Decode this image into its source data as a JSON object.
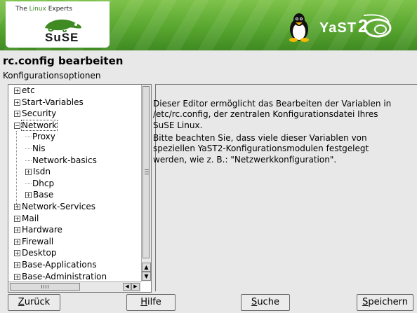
{
  "header": {
    "brand_tagline_prefix": "The ",
    "brand_tagline_highlight": "Linux",
    "brand_tagline_suffix": " Experts",
    "brand_name": "SuSE",
    "product_name": "YaST",
    "product_version": "2",
    "colors": {
      "banner": "#58a630",
      "logo_green": "#3f8a22"
    }
  },
  "dialog": {
    "title": "rc.config bearbeiten",
    "section_label": "Konfigurationsoptionen"
  },
  "tree": {
    "items": [
      {
        "label": "etc",
        "expander": "+",
        "level": 0
      },
      {
        "label": "Start-Variables",
        "expander": "+",
        "level": 0
      },
      {
        "label": "Security",
        "expander": "+",
        "level": 0
      },
      {
        "label": "Network",
        "expander": "−",
        "level": 0,
        "selected": true
      },
      {
        "label": "Proxy",
        "expander": "",
        "level": 1
      },
      {
        "label": "Nis",
        "expander": "",
        "level": 1
      },
      {
        "label": "Network-basics",
        "expander": "",
        "level": 1
      },
      {
        "label": "Isdn",
        "expander": "+",
        "level": 1
      },
      {
        "label": "Dhcp",
        "expander": "",
        "level": 1
      },
      {
        "label": "Base",
        "expander": "+",
        "level": 1
      },
      {
        "label": "Network-Services",
        "expander": "+",
        "level": 0
      },
      {
        "label": "Mail",
        "expander": "+",
        "level": 0
      },
      {
        "label": "Hardware",
        "expander": "+",
        "level": 0
      },
      {
        "label": "Firewall",
        "expander": "+",
        "level": 0
      },
      {
        "label": "Desktop",
        "expander": "+",
        "level": 0
      },
      {
        "label": "Base-Applications",
        "expander": "+",
        "level": 0
      },
      {
        "label": "Base-Administration",
        "expander": "+",
        "level": 0
      }
    ]
  },
  "help": {
    "paragraph1": "Dieser Editor ermöglicht das Bearbeiten der Variablen in /etc/rc.config, der zentralen Konfigurationsdatei Ihres SuSE Linux.",
    "paragraph2": "Bitte beachten Sie, dass viele dieser Variablen von speziellen YaST2-Konfigurationsmodulen festgelegt werden, wie z. B.: \"Netzwerkkonfiguration\"."
  },
  "buttons": {
    "back": {
      "mnemonic": "Z",
      "rest": "urück"
    },
    "help": {
      "mnemonic": "H",
      "rest": "ilfe"
    },
    "search": {
      "mnemonic": "S",
      "rest": "uche"
    },
    "save": {
      "mnemonic": "S",
      "rest": "peichern"
    }
  }
}
